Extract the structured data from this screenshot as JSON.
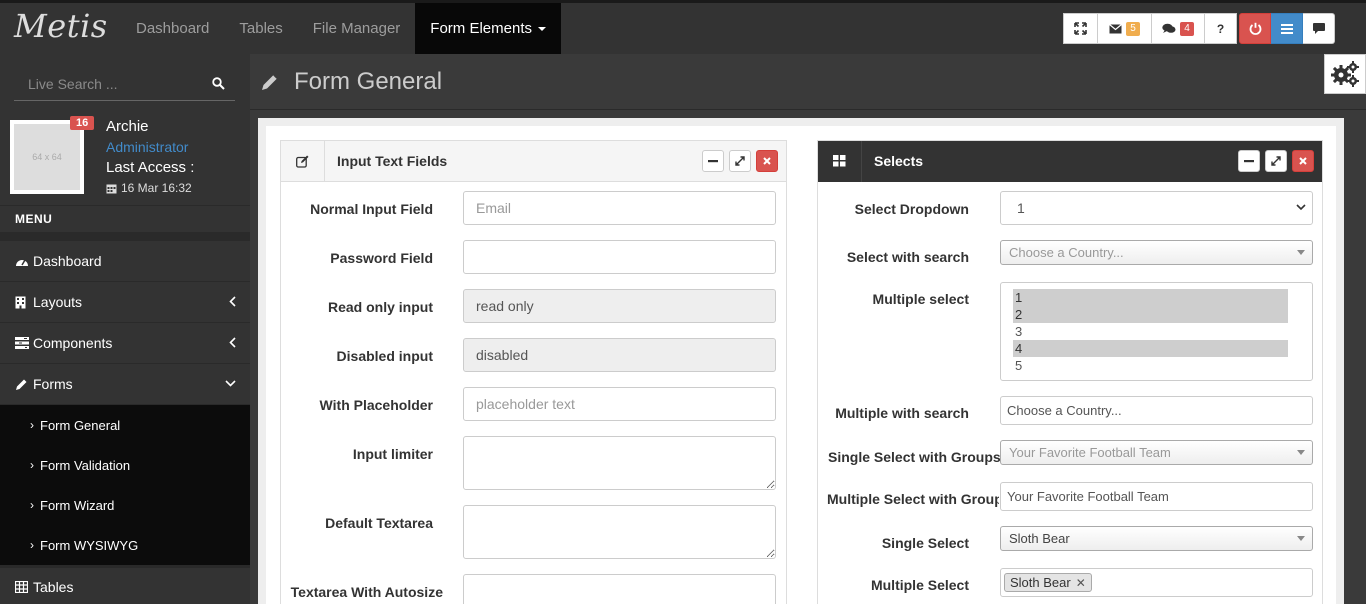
{
  "brand": {
    "logo": "Metis"
  },
  "nav": {
    "items": [
      "Dashboard",
      "Tables",
      "File Manager"
    ],
    "active": "Form Elements"
  },
  "toolbar": {
    "mail_count": "5",
    "comment_count": "4",
    "help_label": "?"
  },
  "sidebar": {
    "search_placeholder": "Live Search ...",
    "user": {
      "avatar_text": "64 x 64",
      "badge": "16",
      "name": "Archie",
      "role": "Administrator",
      "access_label": "Last Access :",
      "access_date": "16 Mar 16:32"
    },
    "menu_header": "MENU",
    "items": [
      {
        "label": "Dashboard"
      },
      {
        "label": "Layouts"
      },
      {
        "label": "Components"
      },
      {
        "label": "Forms"
      }
    ],
    "sub_items": [
      "Form General",
      "Form Validation",
      "Form Wizard",
      "Form WYSIWYG"
    ],
    "tables_label": "Tables"
  },
  "page": {
    "title": "Form General"
  },
  "input_box": {
    "title": "Input Text Fields",
    "fields": [
      {
        "label": "Normal Input Field",
        "placeholder": "Email",
        "value": ""
      },
      {
        "label": "Password Field",
        "placeholder": "",
        "value": ""
      },
      {
        "label": "Read only input",
        "placeholder": "",
        "value": "read only"
      },
      {
        "label": "Disabled input",
        "placeholder": "",
        "value": "disabled"
      },
      {
        "label": "With Placeholder",
        "placeholder": "placeholder text",
        "value": ""
      },
      {
        "label": "Input limiter"
      },
      {
        "label": "Default Textarea"
      },
      {
        "label": "Textarea With Autosize"
      }
    ]
  },
  "selects_box": {
    "title": "Selects",
    "select_dropdown": {
      "label": "Select Dropdown",
      "value": "1"
    },
    "select_search": {
      "label": "Select with search",
      "value": "Choose a Country..."
    },
    "multiple_select": {
      "label": "Multiple select",
      "options": [
        {
          "text": "1",
          "selected": true
        },
        {
          "text": "2",
          "selected": true
        },
        {
          "text": "3",
          "selected": false
        },
        {
          "text": "4",
          "selected": true
        },
        {
          "text": "5",
          "selected": false
        }
      ]
    },
    "multiple_search": {
      "label": "Multiple with search",
      "value": "Choose a Country..."
    },
    "single_groups": {
      "label": "Single Select with Groups",
      "value": "Your Favorite Football Team"
    },
    "multiple_groups": {
      "label": "Multiple Select with Groups",
      "value": "Your Favorite Football Team"
    },
    "single_select": {
      "label": "Single Select",
      "value": "Sloth Bear"
    },
    "multi_select": {
      "label": "Multiple Select",
      "tags": [
        "Sloth Bear"
      ]
    }
  }
}
